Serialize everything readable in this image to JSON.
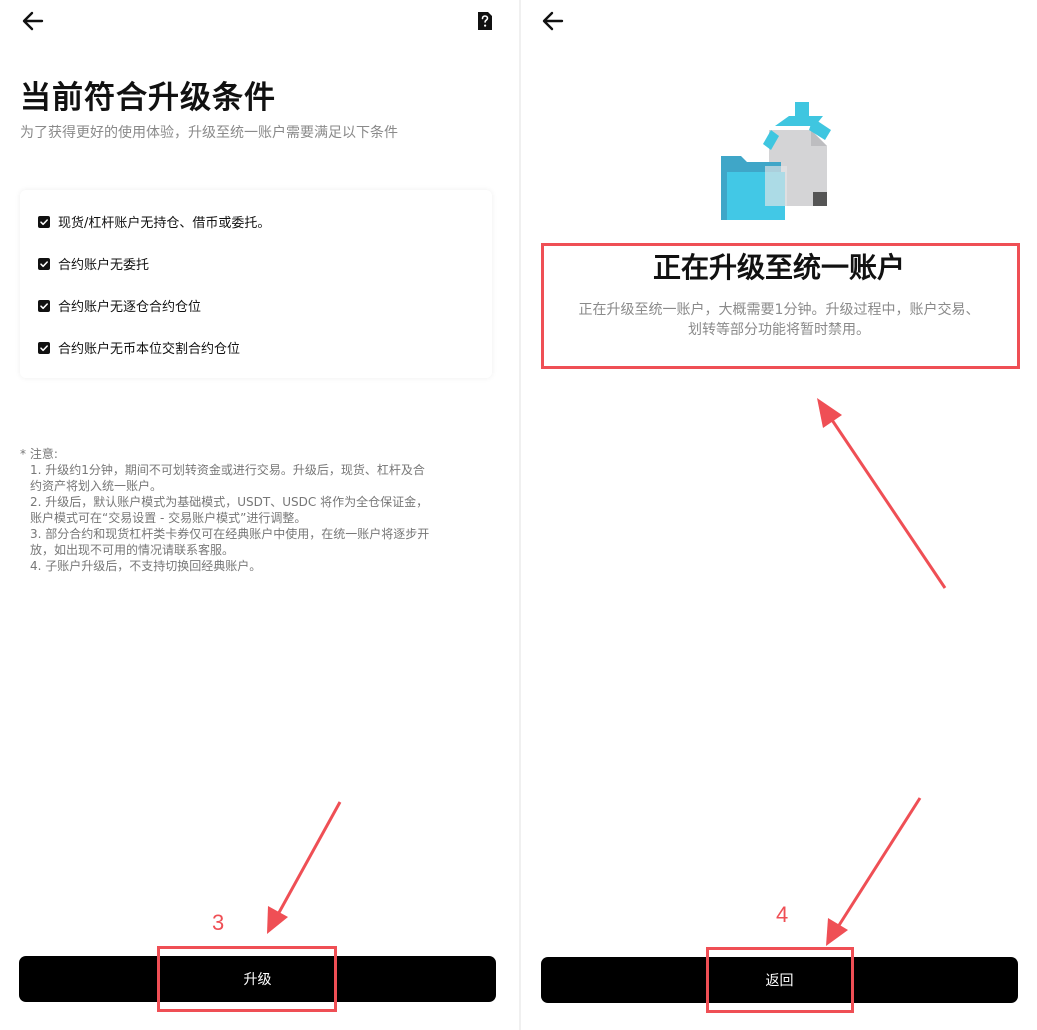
{
  "left": {
    "title": "当前符合升级条件",
    "subtitle": "为了获得更好的使用体验，升级至统一账户需要满足以下条件",
    "conditions": [
      "现货/杠杆账户无持仓、借币或委托。",
      "合约账户无委托",
      "合约账户无逐仓合约仓位",
      "合约账户无币本位交割合约仓位"
    ],
    "notes_heading": "* 注意:",
    "notes": [
      "1. 升级约1分钟，期间不可划转资金或进行交易。升级后，现货、杠杆及合",
      "约资产将划入统一账户。",
      "2. 升级后，默认账户模式为基础模式，USDT、USDC 将作为全仓保证金，",
      "账户模式可在“交易设置 - 交易账户模式”进行调整。",
      "3. 部分合约和现货杠杆类卡券仅可在经典账户中使用，在统一账户将逐步开",
      "放，如出现不可用的情况请联系客服。",
      "4. 子账户升级后，不支持切换回经典账户。"
    ],
    "button_label": "升级",
    "step_number": "3"
  },
  "right": {
    "title": "正在升级至统一账户",
    "description_line1": "正在升级至统一账户，大概需要1分钟。升级过程中，账户交易、",
    "description_line2": "划转等部分功能将暂时禁用。",
    "button_label": "返回",
    "step_number": "4"
  },
  "icons": {
    "back": "arrow-left-icon",
    "help": "help-document-icon",
    "checkbox": "checked-checkbox-icon",
    "illustration": "folder-document-upgrade-illustration"
  },
  "colors": {
    "button_bg": "#000000",
    "annotation_red": "#ef4f55",
    "illustration_cyan": "#3fc6e0",
    "muted_text": "#8a8a8a"
  }
}
